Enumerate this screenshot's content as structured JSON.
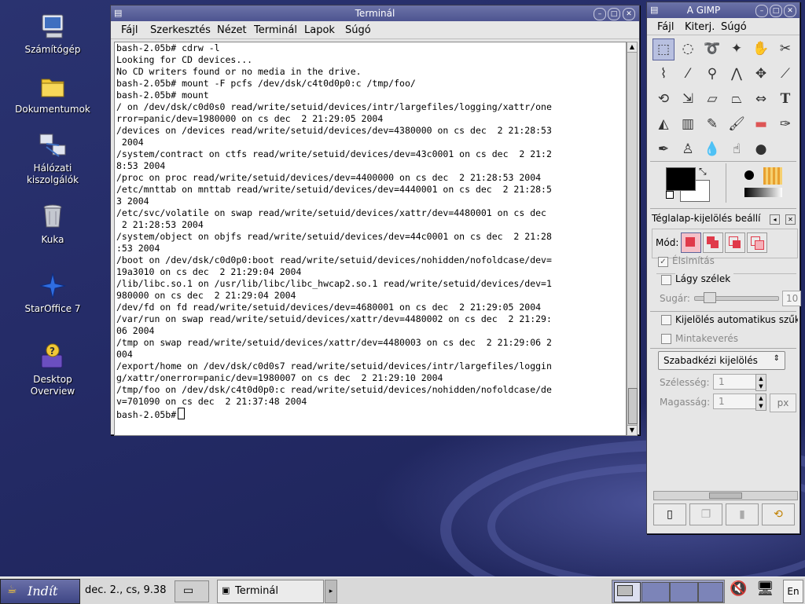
{
  "desktop": {
    "icons": [
      {
        "label": "Számítógép",
        "icon": "computer-icon"
      },
      {
        "label": "Dokumentumok",
        "icon": "folder-icon"
      },
      {
        "label": "Hálózati\nkiszolgálók",
        "icon": "network-icon"
      },
      {
        "label": "Kuka",
        "icon": "trash-icon"
      },
      {
        "label": "StarOffice 7",
        "icon": "staroffice-icon"
      },
      {
        "label": "Desktop\nOverview",
        "icon": "help-icon"
      }
    ]
  },
  "terminal": {
    "title": "Terminál",
    "menu": [
      "Fájl",
      "Szerkesztés",
      "Nézet",
      "Terminál",
      "Lapok",
      "Súgó"
    ],
    "lines": [
      "bash-2.05b# cdrw -l",
      "Looking for CD devices...",
      "No CD writers found or no media in the drive.",
      "bash-2.05b# mount -F pcfs /dev/dsk/c4t0d0p0:c /tmp/foo/",
      "bash-2.05b# mount",
      "/ on /dev/dsk/c0d0s0 read/write/setuid/devices/intr/largefiles/logging/xattr/one",
      "rror=panic/dev=1980000 on cs dec  2 21:29:05 2004",
      "/devices on /devices read/write/setuid/devices/dev=4380000 on cs dec  2 21:28:53",
      " 2004",
      "/system/contract on ctfs read/write/setuid/devices/dev=43c0001 on cs dec  2 21:2",
      "8:53 2004",
      "/proc on proc read/write/setuid/devices/dev=4400000 on cs dec  2 21:28:53 2004",
      "/etc/mnttab on mnttab read/write/setuid/devices/dev=4440001 on cs dec  2 21:28:5",
      "3 2004",
      "/etc/svc/volatile on swap read/write/setuid/devices/xattr/dev=4480001 on cs dec",
      " 2 21:28:53 2004",
      "/system/object on objfs read/write/setuid/devices/dev=44c0001 on cs dec  2 21:28",
      ":53 2004",
      "/boot on /dev/dsk/c0d0p0:boot read/write/setuid/devices/nohidden/nofoldcase/dev=",
      "19a3010 on cs dec  2 21:29:04 2004",
      "/lib/libc.so.1 on /usr/lib/libc/libc_hwcap2.so.1 read/write/setuid/devices/dev=1",
      "980000 on cs dec  2 21:29:04 2004",
      "/dev/fd on fd read/write/setuid/devices/dev=4680001 on cs dec  2 21:29:05 2004",
      "/var/run on swap read/write/setuid/devices/xattr/dev=4480002 on cs dec  2 21:29:",
      "06 2004",
      "/tmp on swap read/write/setuid/devices/xattr/dev=4480003 on cs dec  2 21:29:06 2",
      "004",
      "/export/home on /dev/dsk/c0d0s7 read/write/setuid/devices/intr/largefiles/loggin",
      "g/xattr/onerror=panic/dev=1980007 on cs dec  2 21:29:10 2004",
      "/tmp/foo on /dev/dsk/c4t0d0p0:c read/write/setuid/devices/nohidden/nofoldcase/de",
      "v=701090 on cs dec  2 21:37:48 2004"
    ],
    "prompt": "bash-2.05b# "
  },
  "gimp": {
    "title": "A GIMP",
    "menu": [
      "Fájl",
      "Kiterj.",
      "Súgó"
    ],
    "options_title": "Téglalap-kijelölés beállí",
    "mode_label": "Mód:",
    "antialias_label": "Élsimítás",
    "feather_label": "Lágy szélek",
    "radius_label": "Sugár:",
    "radius_value": "10",
    "auto_shrink_label": "Kijelölés automatikus szűk",
    "sample_merged_label": "Mintakeverés",
    "selection_mode": "Szabadkézi kijelölés",
    "width_label": "Szélesség:",
    "width_value": "1",
    "height_label": "Magasság:",
    "height_value": "1",
    "unit": "px"
  },
  "taskbar": {
    "start_label": "Indít",
    "clock": "dec. 2., cs,  9.38",
    "task_terminal": "Terminál",
    "lang": "En"
  }
}
